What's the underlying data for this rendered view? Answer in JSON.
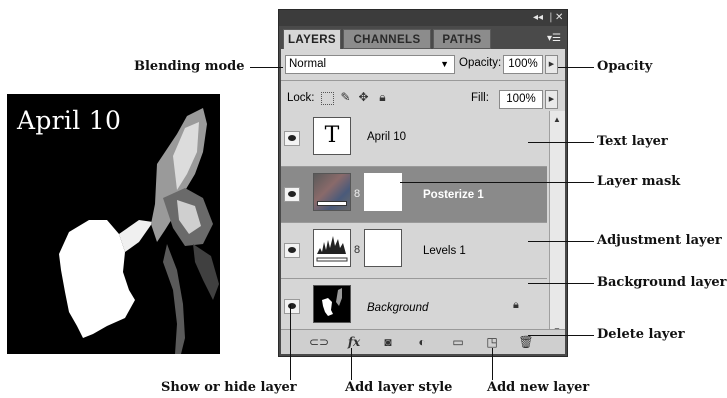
{
  "preview": {
    "caption": "April 10"
  },
  "panel": {
    "controls": "◂◂ | ✕",
    "tabs": [
      "LAYERS",
      "CHANNELS",
      "PATHS"
    ],
    "menu_icon": "panel-menu-icon",
    "blend_mode": "Normal",
    "opacity_label": "Opacity:",
    "opacity_value": "100%",
    "lock_label": "Lock:",
    "fill_label": "Fill:",
    "fill_value": "100%",
    "layers": [
      {
        "name": "April 10",
        "type": "text",
        "thumb": "T"
      },
      {
        "name": "Posterize 1",
        "type": "adjustment",
        "selected": true
      },
      {
        "name": "Levels 1",
        "type": "adjustment"
      },
      {
        "name": "Background",
        "type": "background",
        "locked": true
      }
    ]
  },
  "callouts": {
    "blending_mode": "Blending mode",
    "opacity": "Opacity",
    "text_layer": "Text layer",
    "layer_mask": "Layer mask",
    "adjustment_layer": "Adjustment layer",
    "background_layer": "Background layer",
    "delete_layer": "Delete layer",
    "show_hide": "Show or hide layer",
    "add_style": "Add layer style",
    "add_new": "Add new layer"
  }
}
